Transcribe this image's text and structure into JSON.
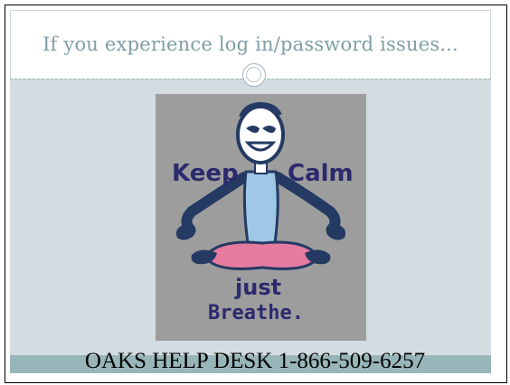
{
  "slide": {
    "title": "If you experience log in/password issues...",
    "footer_text": "OAKS HELP DESK 1-866-509-6257"
  },
  "poster": {
    "line1_left": "Keep",
    "line1_right": "Calm",
    "line2": "just",
    "line3": "Breathe."
  },
  "colors": {
    "title_text": "#7f9ea4",
    "body_bg": "#d3dde1",
    "footer_band": "#98b6b9",
    "poster_bg": "#9d9d9d",
    "poster_text_navy": "#2b2a6e",
    "figure_blue": "#243a63",
    "shirt": "#9fc7e6",
    "pants": "#e67ba0"
  },
  "icons": [
    "circle-ornament-icon",
    "meditating-figure-icon"
  ]
}
